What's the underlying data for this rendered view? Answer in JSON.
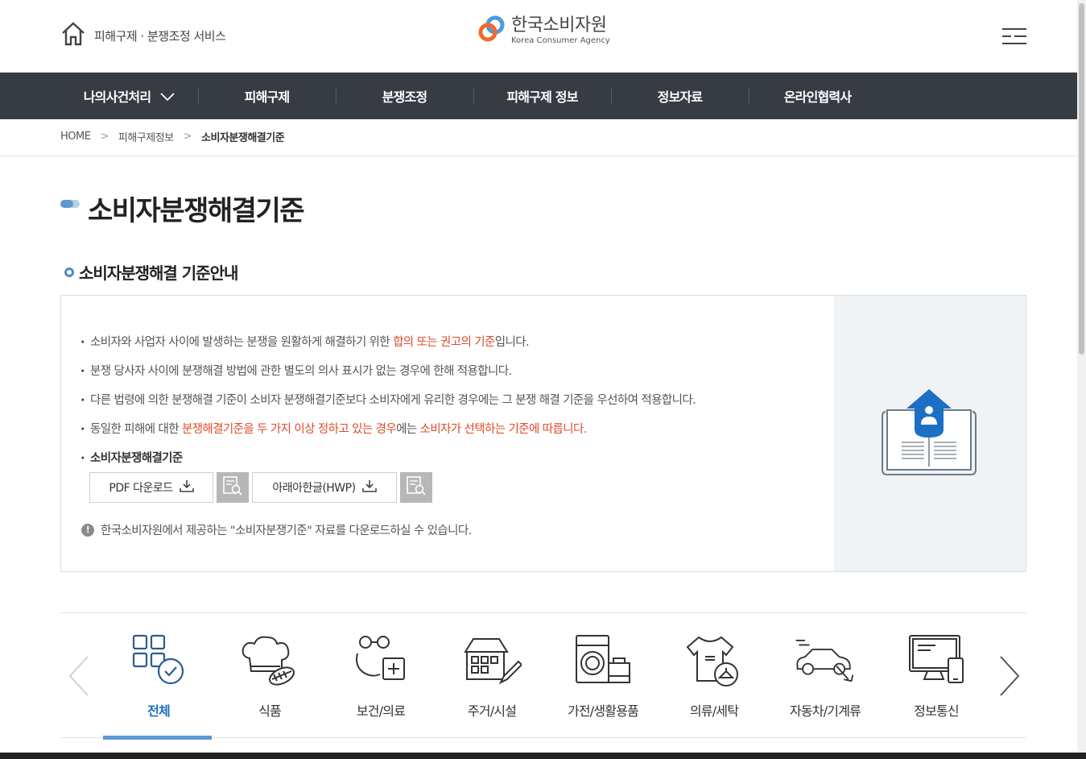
{
  "header": {
    "home_label": "피해구제 · 분쟁조정 서비스",
    "logo_ko": "한국소비자원",
    "logo_en": "Korea Consumer Agency"
  },
  "gnb": {
    "items": [
      "나의사건처리",
      "피해구제",
      "분쟁조정",
      "피해구제 정보",
      "정보자료",
      "온라인협력사"
    ]
  },
  "breadcrumb": {
    "home": "HOME",
    "level1": "피해구제정보",
    "current": "소비자분쟁해결기준"
  },
  "page_title": "소비자분쟁해결기준",
  "section_title": "소비자분쟁해결 기준안내",
  "info": {
    "line1_pre": "소비자와 사업자 사이에 발생하는 분쟁을 원활하게 해결하기 위한 ",
    "line1_red": "합의 또는 권고의 기준",
    "line1_post": "입니다.",
    "line2": "분쟁 당사자 사이에 분쟁해결 방법에 관한 별도의 의사 표시가 없는 경우에 한해 적용합니다.",
    "line3": "다른 법령에 의한 분쟁해결 기준이 소비자 분쟁해결기준보다 소비자에게 유리한 경우에는 그 분쟁 해결 기준을 우선하여 적용합니다.",
    "line4_pre": "동일한 피해에 대한 ",
    "line4_red1": "분쟁해결기준을 두 가지 이상 정하고 있는 경우",
    "line4_mid": "에는 ",
    "line4_red2": "소비자가 선택하는 기준에 따릅니다.",
    "line5": "소비자분쟁해결기준",
    "pdf_label": "PDF 다운로드",
    "hwp_label": "아래아한글(HWP)",
    "notice": "한국소비자원에서 제공하는 \"소비자분쟁기준\" 자료를 다운로드하실 수 있습니다.",
    "notice_mark": "!"
  },
  "categories": [
    {
      "label": "전체",
      "icon": "grid-check-icon",
      "active": true
    },
    {
      "label": "식품",
      "icon": "chef-hat-icon",
      "active": false
    },
    {
      "label": "보건/의료",
      "icon": "medical-icon",
      "active": false
    },
    {
      "label": "주거/시설",
      "icon": "house-icon",
      "active": false
    },
    {
      "label": "가전/생활용품",
      "icon": "appliance-icon",
      "active": false
    },
    {
      "label": "의류/세탁",
      "icon": "clothing-icon",
      "active": false
    },
    {
      "label": "자동차/기계류",
      "icon": "car-icon",
      "active": false
    },
    {
      "label": "정보통신",
      "icon": "computer-icon",
      "active": false
    }
  ],
  "colors": {
    "nav_bg": "#373b42",
    "accent_blue": "#1a6fbf",
    "highlight_red": "#e04a2a"
  }
}
